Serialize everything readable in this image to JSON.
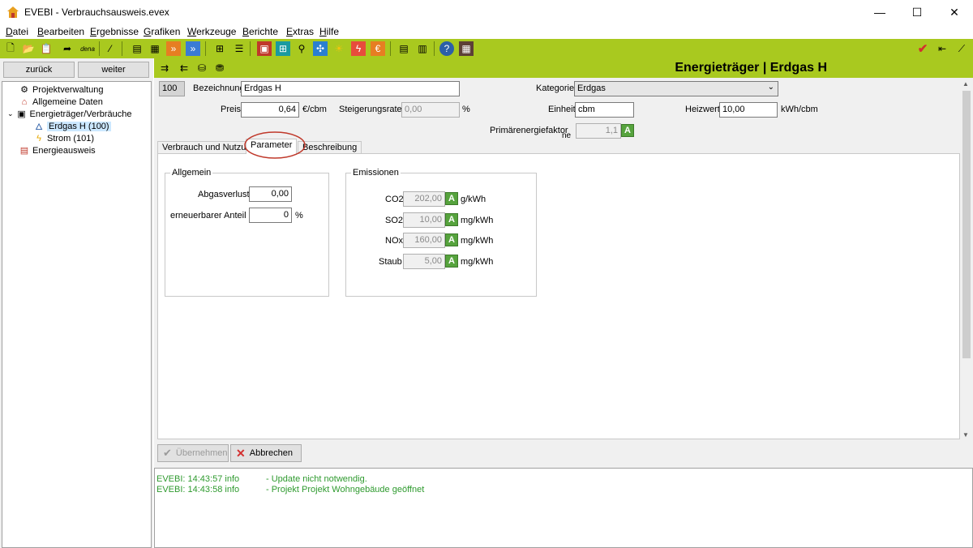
{
  "window": {
    "title": "EVEBI - Verbrauchsausweis.evex",
    "minimize": "—",
    "maximize": "☐",
    "close": "✕"
  },
  "menu": [
    "Datei",
    "Bearbeiten",
    "Ergebnisse",
    "Grafiken",
    "Werkzeuge",
    "Berichte",
    "Extras",
    "Hilfe"
  ],
  "toolbar": {
    "dena_label": "dena"
  },
  "nav": {
    "back": "zurück",
    "forward": "weiter"
  },
  "tree": {
    "items": [
      "Projektverwaltung",
      "Allgemeine Daten",
      "Energieträger/Verbräuche",
      "Erdgas H (100)",
      "Strom (101)",
      "Energieausweis"
    ]
  },
  "header": {
    "title": "Energieträger | Erdgas H"
  },
  "form": {
    "id": "100",
    "bezeichnung_label": "Bezeichnung",
    "bezeichnung_value": "Erdgas H",
    "kategorie_label": "Kategorie",
    "kategorie_value": "Erdgas",
    "preis_label": "Preis",
    "preis_value": "0,64",
    "preis_unit": "€/cbm",
    "steigerung_label": "Steigerungsrate",
    "steigerung_value": "0,00",
    "steigerung_unit": "%",
    "einheit_label": "Einheit",
    "einheit_value": "cbm",
    "heizwert_label": "Heizwert",
    "heizwert_value": "10,00",
    "heizwert_unit": "kWh/cbm",
    "pef_label": "Primärenergiefaktor",
    "pef_sub": "ne",
    "pef_value": "1,1"
  },
  "tabs": [
    "Verbrauch und Nutzung",
    "Parameter",
    "Beschreibung"
  ],
  "allgemein": {
    "title": "Allgemein",
    "abgas_label": "Abgasverlust",
    "abgas_value": "0,00",
    "ee_label": "erneuerbarer Anteil",
    "ee_value": "0",
    "ee_unit": "%"
  },
  "emissionen": {
    "title": "Emissionen",
    "rows": [
      {
        "label": "CO2",
        "value": "202,00",
        "unit": "g/kWh"
      },
      {
        "label": "SO2",
        "value": "10,00",
        "unit": "mg/kWh"
      },
      {
        "label": "NOx",
        "value": "160,00",
        "unit": "mg/kWh"
      },
      {
        "label": "Staub",
        "value": "5,00",
        "unit": "mg/kWh"
      }
    ]
  },
  "buttons": {
    "apply": "Übernehmen",
    "cancel": "Abbrechen",
    "a_label": "A"
  },
  "log": [
    {
      "source": "EVEBI: 14:43:57 info",
      "message": "- Update nicht notwendig."
    },
    {
      "source": "EVEBI: 14:43:58 info",
      "message": "- Projekt Projekt Wohngebäude geöffnet"
    }
  ],
  "colors": {
    "accent": "#a9c91f",
    "log_text": "#2e9a2e",
    "a_button": "#56a33d",
    "highlight_ring": "#c0392b"
  }
}
